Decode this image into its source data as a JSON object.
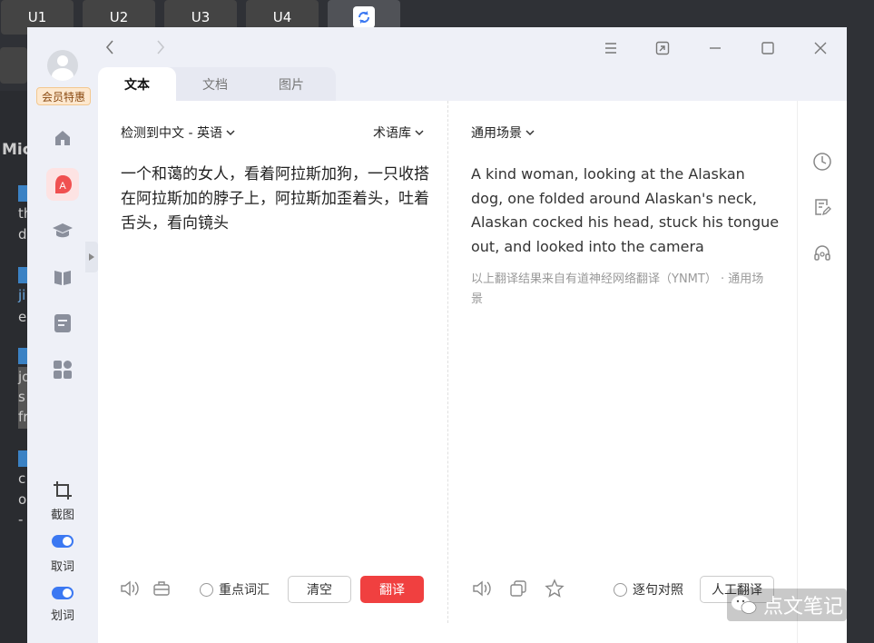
{
  "background": {
    "tabs": [
      "U1",
      "U2",
      "U3",
      "U4"
    ],
    "side_texts": [
      "Mic",
      "th",
      "d",
      "ji",
      "e",
      "jo",
      "s",
      "fr",
      "c",
      "o",
      "-"
    ],
    "accent": "#3b82c4"
  },
  "window": {
    "vip_label": "会员特惠",
    "tools": {
      "screenshot": "截图",
      "pick_word": "取词",
      "select_word": "划词"
    },
    "tabs": [
      {
        "label": "文本"
      },
      {
        "label": "文档"
      },
      {
        "label": "图片"
      }
    ]
  },
  "source": {
    "language_pair": "检测到中文 - 英语",
    "glossary": "术语库",
    "text": "一个和蔼的女人，看着阿拉斯加狗，一只收搭在阿拉斯加的脖子上，阿拉斯加歪着头，吐着舌头，看向镜头",
    "key_vocab_label": "重点词汇",
    "clear_label": "清空",
    "translate_label": "翻译"
  },
  "target": {
    "scene": "通用场景",
    "text": "A kind woman, looking at the Alaskan dog, one folded around Alaskan's neck, Alaskan cocked his head, stuck his tongue out, and looked into the camera",
    "note": "以上翻译结果来自有道神经网络翻译（YNMT） · 通用场景",
    "sentence_compare_label": "逐句对照",
    "human_translate_label": "人工翻译"
  },
  "watermark": "点文笔记",
  "colors": {
    "primary": "#3b78f2",
    "danger": "#f04040",
    "vip_bg": "#fde8cf"
  },
  "icons": [
    "home-icon",
    "ai-icon",
    "course-icon",
    "book-icon",
    "notes-icon",
    "apps-icon",
    "crop-icon",
    "history-icon",
    "edit-icon",
    "headset-icon",
    "speaker-icon",
    "briefcase-icon",
    "copy-icon",
    "star-icon",
    "menu-icon",
    "shrink-icon",
    "minimize-icon",
    "maximize-icon",
    "close-icon",
    "refresh-icon"
  ]
}
